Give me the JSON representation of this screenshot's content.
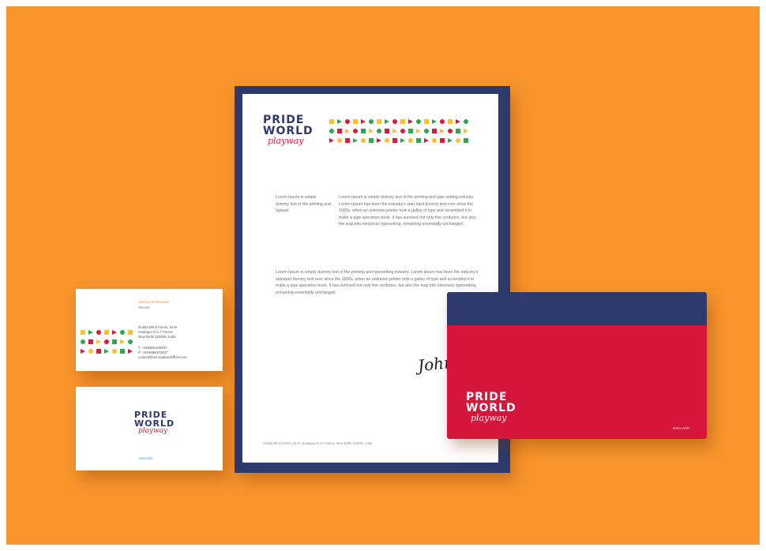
{
  "brand": {
    "line1": "PRIDE",
    "line2": "WORLD",
    "line3": "playway",
    "colors": {
      "background": "#f8952c",
      "navy": "#2d3a6b",
      "red": "#d5163a",
      "yellow": "#fbc02d",
      "green": "#2ea84a",
      "magenta": "#d81b3c"
    }
  },
  "letterhead": {
    "side_note": "Lorem Ipsum is simply dummy text of the printing and typeset",
    "paragraph1": "Lorem Ipsum is simply dummy text of the printing and type setting industry. Lorem Ipsum has been the industry's stan dard dummy text ever since the 1500s, when an unknown printer took a galley of type and scrambled it to make a type specimen book. It has survived not only five centuries, but also the leap into electronic typesetting, remaining essentially unchanged.",
    "paragraph2": "Lorem Ipsum is simply dummy text of the printing and typesetting industry. Lorem Ipsum has been the industry's standard dummy text ever since the 1500s, when an unknown printer took a galley of type and scrambled it to make a type specimen book. It has survived not only five centuries, but also the leap into electronic typesetting, remaining essentially unchanged.",
    "signature": "John",
    "footer_address": "Gulabi Bhuil Farms, 54-B, Gadaipur D.L.F Farms, New Delhi 110030, India"
  },
  "envelope": {
    "small_text": "www.web"
  },
  "business_card": {
    "name": "Vaishali Dhikshwali",
    "role": "Director",
    "address_lines": [
      "Gulabi Bhuil Farms, 54-B",
      "Gadaipur D.L.F Farms",
      "New Delhi 110030, India"
    ],
    "phone": "T: +918860100497",
    "phone2": "P: +919958373237",
    "email": "contact@vermaalandoffice.com",
    "website": "www.web"
  }
}
